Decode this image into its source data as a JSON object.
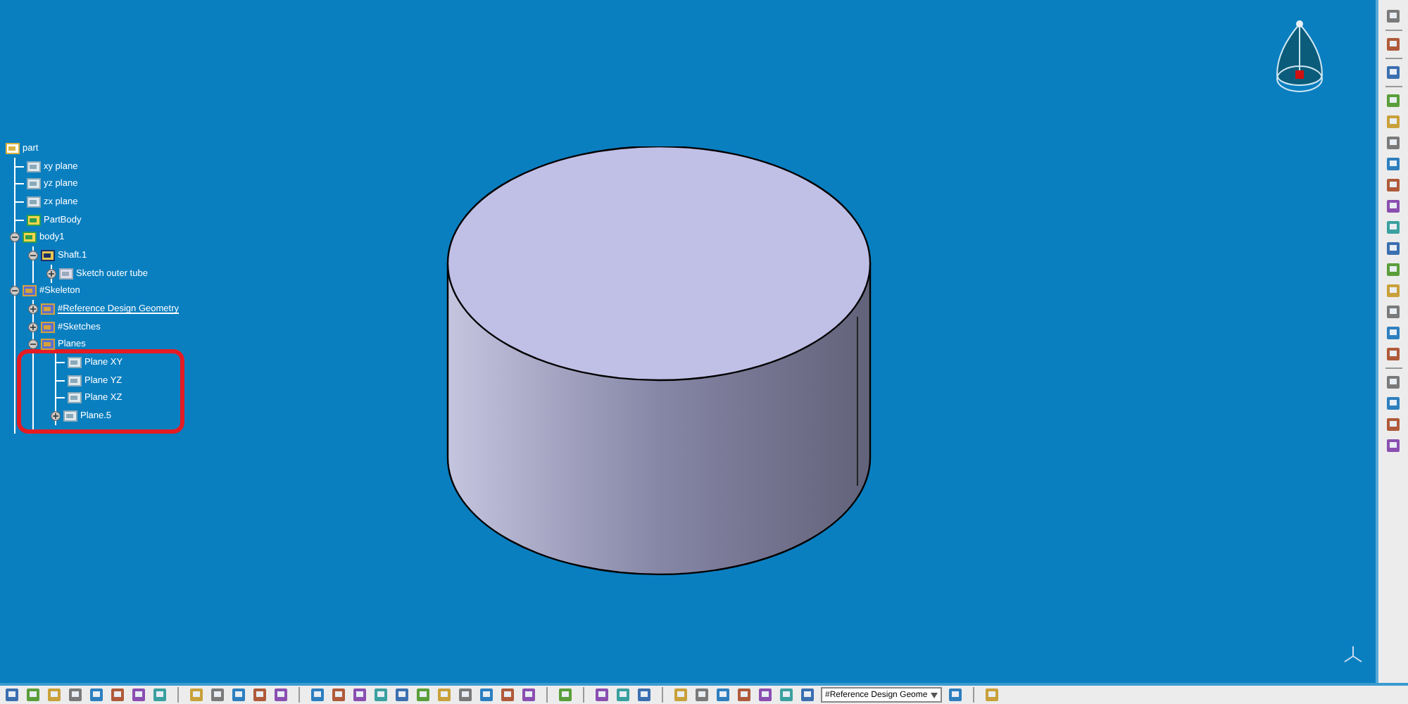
{
  "tree": {
    "label": "part",
    "kind": "part",
    "children": [
      {
        "label": "xy plane",
        "kind": "plane"
      },
      {
        "label": "yz plane",
        "kind": "plane"
      },
      {
        "label": "zx plane",
        "kind": "plane"
      },
      {
        "label": "PartBody",
        "kind": "body"
      },
      {
        "label": "body1",
        "kind": "body",
        "expanded": true,
        "children": [
          {
            "label": "Shaft.1",
            "kind": "shaft",
            "expanded": true,
            "children": [
              {
                "label": "Sketch outer tube",
                "kind": "sketch",
                "expanded": false
              }
            ]
          }
        ]
      },
      {
        "label": "#Skeleton",
        "kind": "geoset",
        "expanded": true,
        "children": [
          {
            "label": "#Reference Design Geometry",
            "kind": "geoset",
            "expanded": false,
            "current": true
          },
          {
            "label": "#Sketches",
            "kind": "geoset",
            "expanded": false
          },
          {
            "label": "Planes",
            "kind": "geoset",
            "expanded": true,
            "highlighted": true,
            "children": [
              {
                "label": "Plane XY",
                "kind": "plane"
              },
              {
                "label": "Plane YZ",
                "kind": "plane"
              },
              {
                "label": "Plane XZ",
                "kind": "plane"
              },
              {
                "label": "Plane.5",
                "kind": "plane",
                "expanded": false
              }
            ]
          }
        ]
      }
    ]
  },
  "toolbar": {
    "geoset_select": {
      "value": "#Reference Design Geome"
    }
  }
}
